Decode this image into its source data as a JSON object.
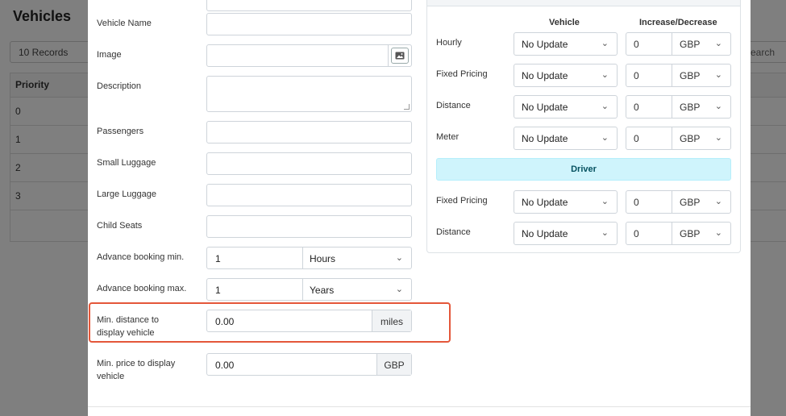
{
  "background": {
    "title": "Vehicles",
    "records": "10 Records",
    "search_partial": "earch",
    "table_header": "Priority",
    "rows": [
      "0",
      "1",
      "2",
      "3"
    ]
  },
  "form": {
    "vehicle_name_label": "Vehicle Name",
    "vehicle_name_value": "",
    "image_label": "Image",
    "description_label": "Description",
    "passengers_label": "Passengers",
    "small_luggage_label": "Small Luggage",
    "large_luggage_label": "Large Luggage",
    "child_seats_label": "Child Seats",
    "advance_min_label": "Advance booking min.",
    "advance_min_value": "1",
    "advance_min_unit": "Hours",
    "advance_max_label": "Advance booking max.",
    "advance_max_value": "1",
    "advance_max_unit": "Years",
    "min_distance_label": "Min. distance to display vehicle",
    "min_distance_value": "0.00",
    "min_distance_unit": "miles",
    "min_price_label": "Min. price to display vehicle",
    "min_price_value": "0.00",
    "min_price_unit": "GBP"
  },
  "pricing": {
    "col_vehicle": "Vehicle",
    "col_increase": "Increase/Decrease",
    "vehicle_rows": [
      {
        "label": "Hourly",
        "select": "No Update",
        "amount": "0",
        "currency": "GBP"
      },
      {
        "label": "Fixed Pricing",
        "select": "No Update",
        "amount": "0",
        "currency": "GBP"
      },
      {
        "label": "Distance",
        "select": "No Update",
        "amount": "0",
        "currency": "GBP"
      },
      {
        "label": "Meter",
        "select": "No Update",
        "amount": "0",
        "currency": "GBP"
      }
    ],
    "driver_label": "Driver",
    "driver_rows": [
      {
        "label": "Fixed Pricing",
        "select": "No Update",
        "amount": "0",
        "currency": "GBP"
      },
      {
        "label": "Distance",
        "select": "No Update",
        "amount": "0",
        "currency": "GBP"
      }
    ]
  },
  "colors": {
    "highlight": "#e4573a",
    "driver_bg": "#cff4fc",
    "overlay": "rgba(0,0,0,0.5)"
  }
}
